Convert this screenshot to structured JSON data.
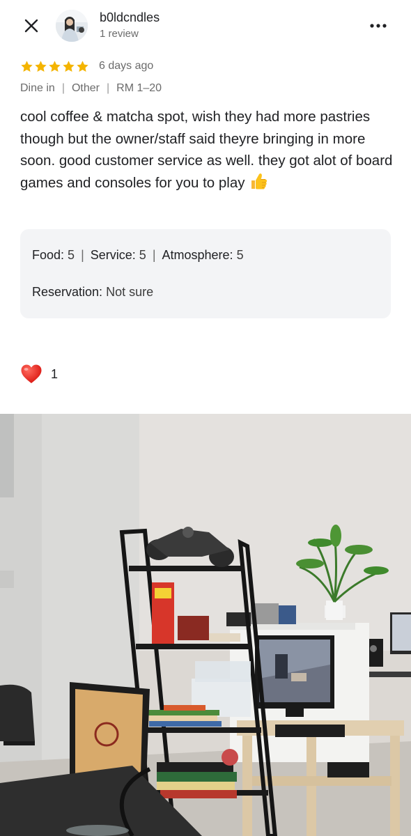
{
  "header": {
    "user_name": "b0ldcndles",
    "review_count": "1 review",
    "close_icon": "close-icon",
    "more_icon": "more-horizontal-icon"
  },
  "review": {
    "rating": 5,
    "rating_max": 5,
    "date": "6 days ago",
    "meta": {
      "dine_mode": "Dine in",
      "meal_type": "Other",
      "price_range": "RM 1–20"
    },
    "text": "cool coffee & matcha spot, wish they had more pastries though but the owner/staff said theyre bringing in more soon. good customer service as well. they got alot of board games and consoles for you to play",
    "text_emoji_icon": "thumbs-up-icon",
    "attributes": {
      "food_label": "Food:",
      "food_value": "5",
      "service_label": "Service:",
      "service_value": "5",
      "atmosphere_label": "Atmosphere:",
      "atmosphere_value": "5",
      "reservation_label": "Reservation:",
      "reservation_value": "Not sure"
    },
    "reaction": {
      "icon": "heart-icon",
      "count": "1"
    }
  },
  "colors": {
    "star": "#f4b400",
    "secondary_text": "#6b6b6b",
    "attr_box_bg": "#f3f4f6",
    "heart": "#e0211f"
  }
}
